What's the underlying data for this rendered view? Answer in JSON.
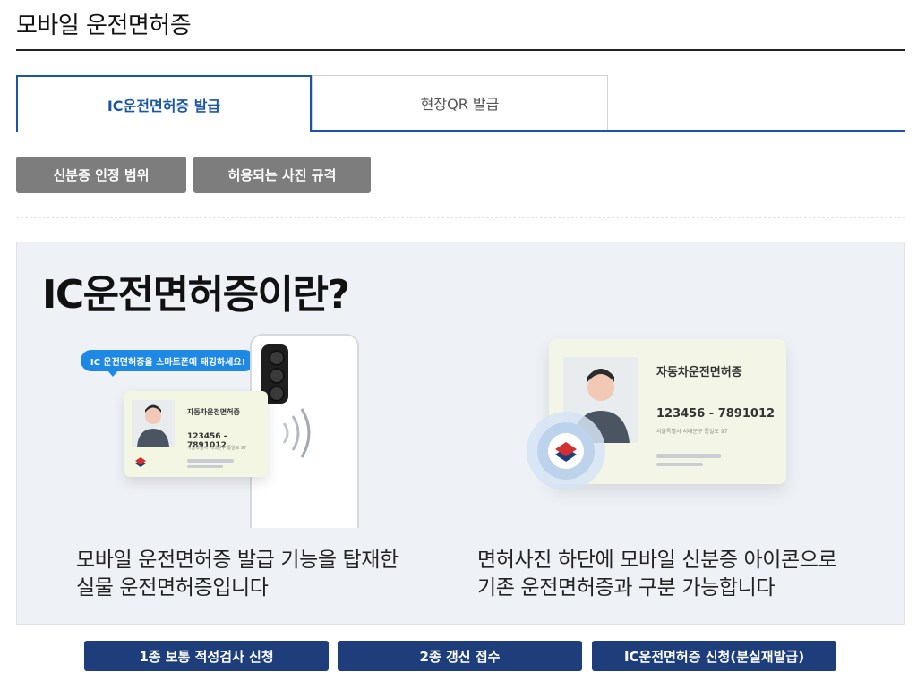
{
  "header": {
    "title": "모바일 운전면허증"
  },
  "tabs": [
    {
      "label": "IC운전면허증 발급",
      "active": true
    },
    {
      "label": "현장QR 발급",
      "active": false
    }
  ],
  "info_buttons": [
    {
      "label": "신분증 인정 범위"
    },
    {
      "label": "허용되는 사진 규격"
    }
  ],
  "panel": {
    "title": "IC운전면허증이란?",
    "left": {
      "bubble": "IC 운전면허증을 스마트폰에 태깅하세요!",
      "card_title": "자동차운전면허증",
      "card_number": "123456 - 7891012",
      "card_address": "서울특별시 서대문구 통일로 97",
      "description_line1": "모바일 운전면허증 발급 기능을 탑재한",
      "description_line2": "실물 운전면허증입니다"
    },
    "right": {
      "card_title": "자동차운전면허증",
      "card_number": "123456 - 7891012",
      "card_address": "서울특별시 서대문구 통일로 97",
      "description_line1": "면허사진 하단에 모바일 신분증 아이콘으로",
      "description_line2": "기존 운전면허증과 구분 가능합니다"
    }
  },
  "action_buttons": [
    {
      "label": "1종 보통 적성검사 신청"
    },
    {
      "label": "2종 갱신 접수"
    },
    {
      "label": "IC운전면허증 신청(분실재발급)"
    }
  ],
  "colors": {
    "accent": "#1a56a6",
    "action": "#1d3e7a",
    "gray_button": "#7d7d7d",
    "panel_bg": "#eef1f6"
  }
}
